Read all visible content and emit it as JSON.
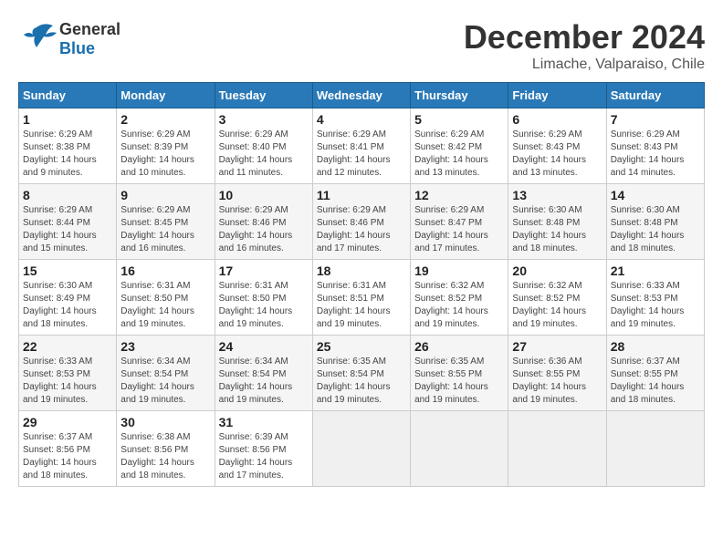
{
  "header": {
    "logo_line1": "General",
    "logo_line2": "Blue",
    "month": "December 2024",
    "location": "Limache, Valparaiso, Chile"
  },
  "weekdays": [
    "Sunday",
    "Monday",
    "Tuesday",
    "Wednesday",
    "Thursday",
    "Friday",
    "Saturday"
  ],
  "weeks": [
    [
      {
        "day": "1",
        "sunrise": "6:29 AM",
        "sunset": "8:38 PM",
        "daylight": "14 hours and 9 minutes."
      },
      {
        "day": "2",
        "sunrise": "6:29 AM",
        "sunset": "8:39 PM",
        "daylight": "14 hours and 10 minutes."
      },
      {
        "day": "3",
        "sunrise": "6:29 AM",
        "sunset": "8:40 PM",
        "daylight": "14 hours and 11 minutes."
      },
      {
        "day": "4",
        "sunrise": "6:29 AM",
        "sunset": "8:41 PM",
        "daylight": "14 hours and 12 minutes."
      },
      {
        "day": "5",
        "sunrise": "6:29 AM",
        "sunset": "8:42 PM",
        "daylight": "14 hours and 13 minutes."
      },
      {
        "day": "6",
        "sunrise": "6:29 AM",
        "sunset": "8:43 PM",
        "daylight": "14 hours and 13 minutes."
      },
      {
        "day": "7",
        "sunrise": "6:29 AM",
        "sunset": "8:43 PM",
        "daylight": "14 hours and 14 minutes."
      }
    ],
    [
      {
        "day": "8",
        "sunrise": "6:29 AM",
        "sunset": "8:44 PM",
        "daylight": "14 hours and 15 minutes."
      },
      {
        "day": "9",
        "sunrise": "6:29 AM",
        "sunset": "8:45 PM",
        "daylight": "14 hours and 16 minutes."
      },
      {
        "day": "10",
        "sunrise": "6:29 AM",
        "sunset": "8:46 PM",
        "daylight": "14 hours and 16 minutes."
      },
      {
        "day": "11",
        "sunrise": "6:29 AM",
        "sunset": "8:46 PM",
        "daylight": "14 hours and 17 minutes."
      },
      {
        "day": "12",
        "sunrise": "6:29 AM",
        "sunset": "8:47 PM",
        "daylight": "14 hours and 17 minutes."
      },
      {
        "day": "13",
        "sunrise": "6:30 AM",
        "sunset": "8:48 PM",
        "daylight": "14 hours and 18 minutes."
      },
      {
        "day": "14",
        "sunrise": "6:30 AM",
        "sunset": "8:48 PM",
        "daylight": "14 hours and 18 minutes."
      }
    ],
    [
      {
        "day": "15",
        "sunrise": "6:30 AM",
        "sunset": "8:49 PM",
        "daylight": "14 hours and 18 minutes."
      },
      {
        "day": "16",
        "sunrise": "6:31 AM",
        "sunset": "8:50 PM",
        "daylight": "14 hours and 19 minutes."
      },
      {
        "day": "17",
        "sunrise": "6:31 AM",
        "sunset": "8:50 PM",
        "daylight": "14 hours and 19 minutes."
      },
      {
        "day": "18",
        "sunrise": "6:31 AM",
        "sunset": "8:51 PM",
        "daylight": "14 hours and 19 minutes."
      },
      {
        "day": "19",
        "sunrise": "6:32 AM",
        "sunset": "8:52 PM",
        "daylight": "14 hours and 19 minutes."
      },
      {
        "day": "20",
        "sunrise": "6:32 AM",
        "sunset": "8:52 PM",
        "daylight": "14 hours and 19 minutes."
      },
      {
        "day": "21",
        "sunrise": "6:33 AM",
        "sunset": "8:53 PM",
        "daylight": "14 hours and 19 minutes."
      }
    ],
    [
      {
        "day": "22",
        "sunrise": "6:33 AM",
        "sunset": "8:53 PM",
        "daylight": "14 hours and 19 minutes."
      },
      {
        "day": "23",
        "sunrise": "6:34 AM",
        "sunset": "8:54 PM",
        "daylight": "14 hours and 19 minutes."
      },
      {
        "day": "24",
        "sunrise": "6:34 AM",
        "sunset": "8:54 PM",
        "daylight": "14 hours and 19 minutes."
      },
      {
        "day": "25",
        "sunrise": "6:35 AM",
        "sunset": "8:54 PM",
        "daylight": "14 hours and 19 minutes."
      },
      {
        "day": "26",
        "sunrise": "6:35 AM",
        "sunset": "8:55 PM",
        "daylight": "14 hours and 19 minutes."
      },
      {
        "day": "27",
        "sunrise": "6:36 AM",
        "sunset": "8:55 PM",
        "daylight": "14 hours and 19 minutes."
      },
      {
        "day": "28",
        "sunrise": "6:37 AM",
        "sunset": "8:55 PM",
        "daylight": "14 hours and 18 minutes."
      }
    ],
    [
      {
        "day": "29",
        "sunrise": "6:37 AM",
        "sunset": "8:56 PM",
        "daylight": "14 hours and 18 minutes."
      },
      {
        "day": "30",
        "sunrise": "6:38 AM",
        "sunset": "8:56 PM",
        "daylight": "14 hours and 18 minutes."
      },
      {
        "day": "31",
        "sunrise": "6:39 AM",
        "sunset": "8:56 PM",
        "daylight": "14 hours and 17 minutes."
      },
      null,
      null,
      null,
      null
    ]
  ],
  "labels": {
    "sunrise": "Sunrise:",
    "sunset": "Sunset:",
    "daylight": "Daylight:"
  }
}
